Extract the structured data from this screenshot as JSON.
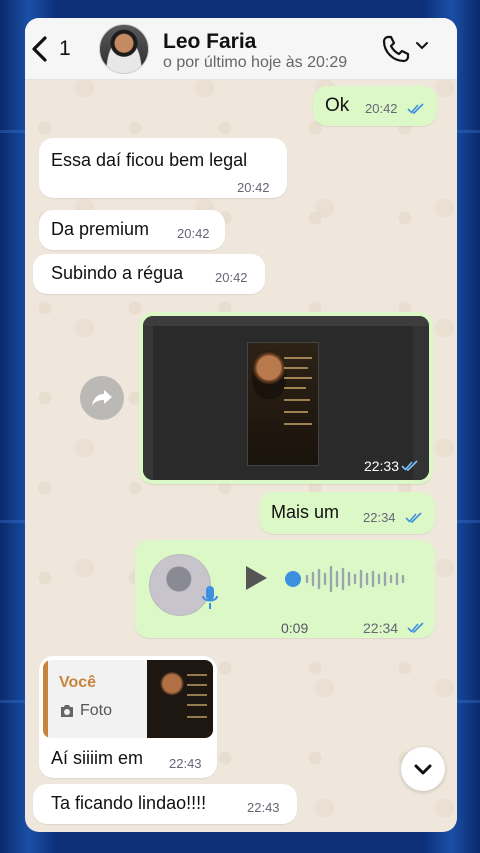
{
  "header": {
    "back_label": "<",
    "unread_count": "1",
    "contact_name": "Leo Faria",
    "last_seen": "o por último hoje às 20:29"
  },
  "messages": [
    {
      "direction": "out",
      "text": "Ok",
      "time": "20:42",
      "read": true
    },
    {
      "direction": "in",
      "text": "Essa daí ficou bem legal",
      "time": "20:42"
    },
    {
      "direction": "in",
      "text": "Da premium",
      "time": "20:42"
    },
    {
      "direction": "in",
      "text": "Subindo a régua",
      "time": "20:42"
    },
    {
      "direction": "out",
      "type": "image",
      "time": "22:33",
      "read": true
    },
    {
      "direction": "out",
      "text": "Mais um",
      "time": "22:34",
      "read": true
    },
    {
      "direction": "out",
      "type": "voice",
      "duration": "0:09",
      "time": "22:34",
      "read": true
    },
    {
      "direction": "in",
      "reply_to": {
        "author": "Você",
        "type": "Foto"
      },
      "text": "Aí siiiim em",
      "time": "22:43"
    },
    {
      "direction": "in",
      "text": "Ta ficando lindao!!!!",
      "time": "22:43"
    }
  ],
  "colors": {
    "incoming_bubble": "#ffffff",
    "outgoing_bubble": "#dcf8c6",
    "chat_background": "#efe7dc",
    "read_ticks": "#3d8fe0",
    "reply_accent": "#c7843a"
  },
  "icons": [
    "chevron-left-icon",
    "phone-icon",
    "chevron-down-icon",
    "forward-icon",
    "play-icon",
    "microphone-icon",
    "camera-icon",
    "double-check-icon",
    "scroll-down-icon"
  ]
}
